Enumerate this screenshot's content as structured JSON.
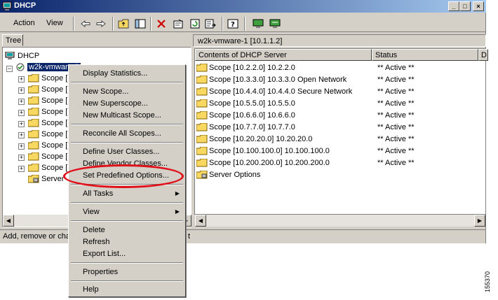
{
  "window": {
    "title": "DHCP",
    "controls": {
      "minimize": "_",
      "maximize": "□",
      "close": "×"
    }
  },
  "menubar": {
    "action": "Action",
    "view": "View"
  },
  "toolbar": {
    "icons": [
      "back-arrow-icon",
      "forward-arrow-icon",
      "up-folder-icon",
      "show-hide-tree-icon",
      "delete-icon",
      "properties-icon",
      "refresh-icon",
      "export-icon",
      "help-icon",
      "console-icon",
      "server-icon"
    ]
  },
  "tree": {
    "tab": "Tree",
    "root": "DHCP",
    "server": "w2k-vmware-1",
    "scopes": [
      "Scope [",
      "Scope [",
      "Scope [",
      "Scope [",
      "Scope [",
      "Scope [",
      "Scope [",
      "Scope [",
      "Scope ["
    ],
    "server_options": "Server"
  },
  "right": {
    "header": "w2k-vmware-1 [10.1.1.2]",
    "columns": [
      "Contents of DHCP Server",
      "Status",
      "D"
    ],
    "rows": [
      {
        "name": "Scope [10.2.2.0] 10.2.2.0",
        "status": "** Active **"
      },
      {
        "name": "Scope [10.3.3.0] 10.3.3.0 Open Network",
        "status": "** Active **"
      },
      {
        "name": "Scope [10.4.4.0] 10.4.4.0 Secure Network",
        "status": "** Active **"
      },
      {
        "name": "Scope [10.5.5.0] 10.5.5.0",
        "status": "** Active **"
      },
      {
        "name": "Scope [10.6.6.0] 10.6.6.0",
        "status": "** Active **"
      },
      {
        "name": "Scope [10.7.7.0] 10.7.7.0",
        "status": "** Active **"
      },
      {
        "name": "Scope [10.20.20.0] 10.20.20.0",
        "status": "** Active **"
      },
      {
        "name": "Scope [10.100.100.0] 10.100.100.0",
        "status": "** Active **"
      },
      {
        "name": "Scope [10.200.200.0] 10.200.200.0",
        "status": "** Active **"
      },
      {
        "name": "Server Options",
        "status": ""
      }
    ]
  },
  "status_bar": {
    "left": "Add, remove or cha",
    "right": "t"
  },
  "context_menu": {
    "display_statistics": "Display Statistics...",
    "new_scope": "New Scope...",
    "new_superscope": "New Superscope...",
    "new_multicast_scope": "New Multicast Scope...",
    "reconcile_all_scopes": "Reconcile All Scopes...",
    "define_user_classes": "Define User Classes...",
    "define_vendor_classes": "Define Vendor Classes...",
    "set_predefined_options": "Set Predefined Options...",
    "all_tasks": "All Tasks",
    "view": "View",
    "delete": "Delete",
    "refresh": "Refresh",
    "export_list": "Export List...",
    "properties": "Properties",
    "help": "Help"
  },
  "figure_number": "155370",
  "colors": {
    "highlight_ellipse": "#e0101a",
    "selection": "#0a246a"
  }
}
